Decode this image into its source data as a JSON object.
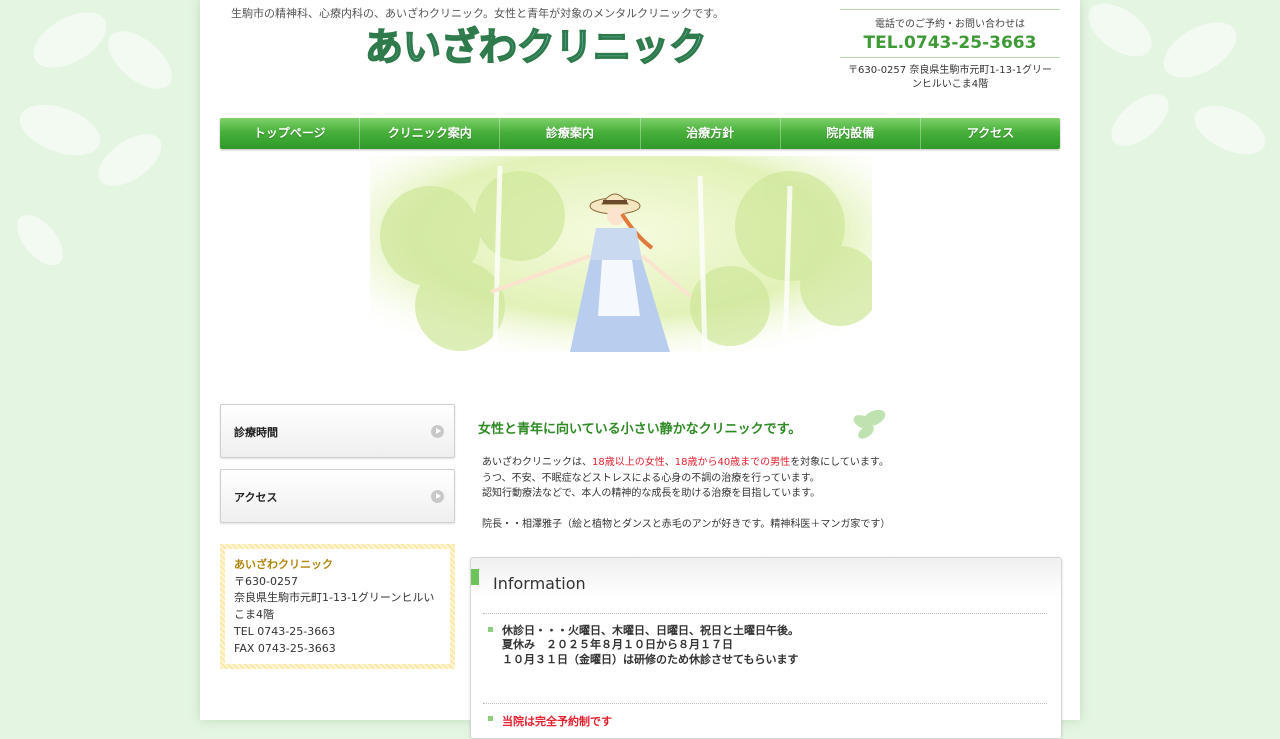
{
  "header": {
    "tagline": "生駒市の精神科、心療内科の、あいざわクリニック。女性と青年が対象のメンタルクリニックです。",
    "logo_text": "あいざわクリニック",
    "contact_lead": "電話でのご予約・お問い合わせは",
    "tel": "TEL.0743-25-3663",
    "address": "〒630-0257 奈良県生駒市元町1-13-1グリーンヒルいこま4階"
  },
  "nav": {
    "items": [
      {
        "label": "トップページ"
      },
      {
        "label": "クリニック案内"
      },
      {
        "label": "診療案内"
      },
      {
        "label": "治療方針"
      },
      {
        "label": "院内設備"
      },
      {
        "label": "アクセス"
      }
    ]
  },
  "sidebar": {
    "buttons": [
      {
        "label": "診療時間"
      },
      {
        "label": "アクセス"
      }
    ],
    "info": {
      "name": "あいざわクリニック",
      "postal": "〒630-0257",
      "address": "奈良県生駒市元町1-13-1グリーンヒルいこま4階",
      "tel": "TEL 0743-25-3663",
      "fax": "FAX 0743-25-3663"
    }
  },
  "main": {
    "heading": "女性と青年に向いている小さい静かなクリニックです。",
    "intro": {
      "line1_pre": "あいざわクリニックは、",
      "line1_red1": "18歳以上の女性",
      "line1_sep": "、",
      "line1_red2": "18歳から40歳までの男性",
      "line1_post": "を対象にしています。",
      "line2": "うつ、不安、不眠症などストレスによる心身の不調の治療を行っています。",
      "line3": "認知行動療法などで、本人の精神的な成長を助ける治療を目指しています。",
      "line4": "院長・・相澤雅子（絵と植物とダンスと赤毛のアンが好きです。精神科医＋マンガ家です）"
    },
    "information": {
      "title": "Information",
      "news_lines": [
        "休診日・・・火曜日、木曜日、日曜日、祝日と土曜日午後。",
        "夏休み　２０２５年８月１０日から８月１７日",
        "１０月３１日（金曜日）は研修のため休診させてもらいます"
      ],
      "news2": "当院は完全予約制です"
    }
  },
  "colors": {
    "accent_green": "#3e9a35",
    "nav_green": "#48b03a",
    "highlight_red": "#e2222f",
    "clinic_name_gold": "#b0860c"
  }
}
